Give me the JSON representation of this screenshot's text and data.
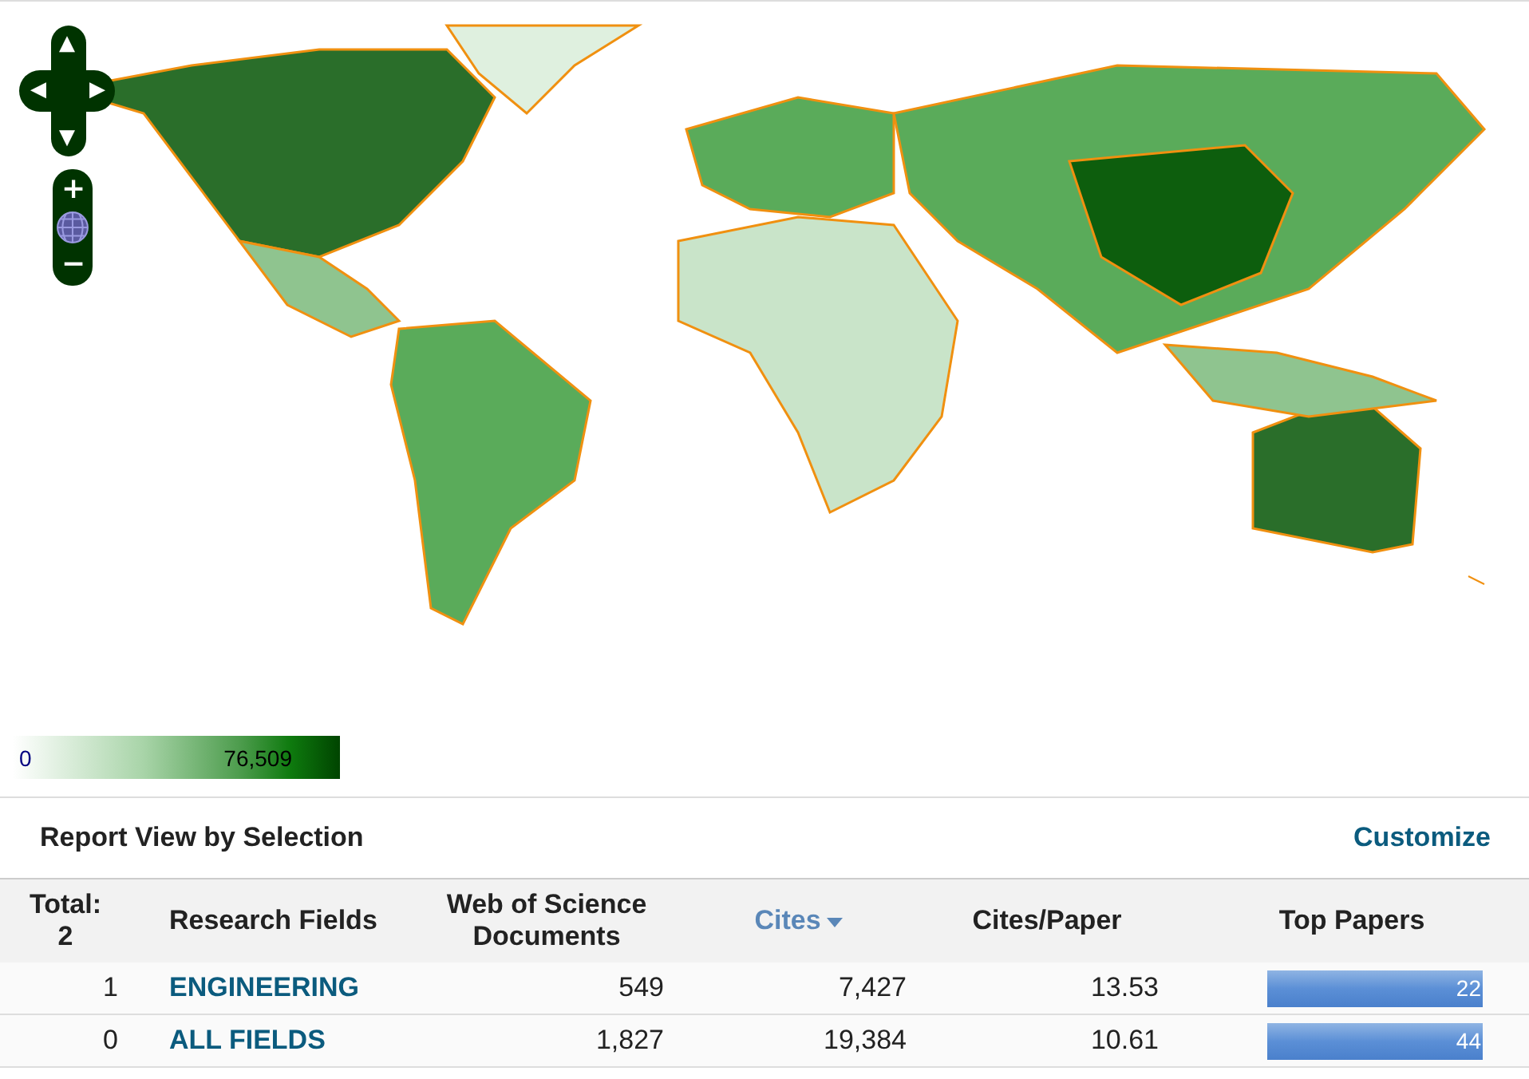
{
  "map": {
    "controls": {
      "pan_up": "▲",
      "pan_left": "◀",
      "pan_right": "▶",
      "pan_down": "▼",
      "zoom_in": "+",
      "zoom_out": "−"
    },
    "legend": {
      "min": "0",
      "max": "76,509"
    }
  },
  "report": {
    "title": "Report View by Selection",
    "customize": "Customize"
  },
  "table": {
    "total_label": "Total:",
    "total_count": "2",
    "columns": [
      {
        "label": "Research Fields",
        "sorted": false
      },
      {
        "label": "Web of Science Documents",
        "sorted": false
      },
      {
        "label": "Cites",
        "sorted": true
      },
      {
        "label": "Cites/Paper",
        "sorted": false
      },
      {
        "label": "Top Papers",
        "sorted": false
      }
    ],
    "rows": [
      {
        "rank": "1",
        "field": "ENGINEERING",
        "documents": "549",
        "cites": "7,427",
        "cites_per_paper": "13.53",
        "top_papers": "22",
        "level": 1
      },
      {
        "rank": "0",
        "field": "ALL FIELDS",
        "documents": "1,827",
        "cites": "19,384",
        "cites_per_paper": "10.61",
        "top_papers": "44",
        "level": 1
      }
    ]
  }
}
